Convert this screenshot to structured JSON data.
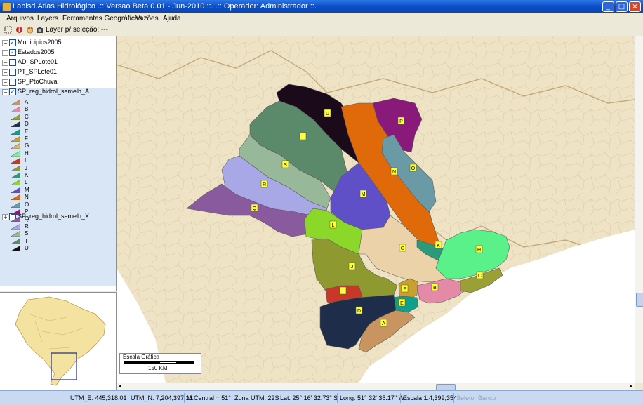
{
  "window": {
    "title": "Labisd.Atlas Hidrológico  .:: Versao Beta 0.01 - Jun-2010 ::.        .:: Operador:  Administrador  ::."
  },
  "menu": [
    "Arquivos",
    "Layers",
    "Ferramentas Geográficas",
    "Vazões",
    "Ajuda"
  ],
  "toolbar": {
    "icons": [
      "select-icon",
      "info-icon",
      "hand-icon",
      "camera-icon"
    ],
    "layer_label": "Layer p/ seleção: ---"
  },
  "layers": [
    {
      "name": "Municipios2005",
      "checked": true
    },
    {
      "name": "Estados2005",
      "checked": true
    },
    {
      "name": "AD_SPLote01",
      "checked": false
    },
    {
      "name": "PT_SPLote01",
      "checked": false
    },
    {
      "name": "SP_PtoChuva",
      "checked": false
    },
    {
      "name": "SP_reg_hidrol_semelh_A",
      "checked": true
    },
    {
      "name": "SP_reg_hidrol_semelh_X",
      "checked": false
    }
  ],
  "legend": [
    {
      "label": "A",
      "color": "#c89460"
    },
    {
      "label": "B",
      "color": "#e58aa6"
    },
    {
      "label": "C",
      "color": "#9aa036"
    },
    {
      "label": "D",
      "color": "#1e2d4a"
    },
    {
      "label": "E",
      "color": "#10a08a"
    },
    {
      "label": "F",
      "color": "#c8a030"
    },
    {
      "label": "G",
      "color": "#d8b870"
    },
    {
      "label": "H",
      "color": "#7cf09a"
    },
    {
      "label": "I",
      "color": "#c83828"
    },
    {
      "label": "J",
      "color": "#8e9a30"
    },
    {
      "label": "K",
      "color": "#2a9a7a"
    },
    {
      "label": "L",
      "color": "#8cd82a"
    },
    {
      "label": "M",
      "color": "#6050c8"
    },
    {
      "label": "N",
      "color": "#e06a0a"
    },
    {
      "label": "O",
      "color": "#6a9aa6"
    },
    {
      "label": "P",
      "color": "#8a1a7a"
    },
    {
      "label": "Q",
      "color": "#8a5a9e"
    },
    {
      "label": "R",
      "color": "#a8a8e6"
    },
    {
      "label": "S",
      "color": "#98b89a"
    },
    {
      "label": "T",
      "color": "#5a8a6a"
    },
    {
      "label": "U",
      "color": "#1a0a1a"
    }
  ],
  "map": {
    "regions": [
      {
        "label": "U",
        "color": "#1a0a1a"
      },
      {
        "label": "P",
        "color": "#8a1a7a"
      },
      {
        "label": "T",
        "color": "#5a8a6a"
      },
      {
        "label": "N",
        "color": "#e06a0a"
      },
      {
        "label": "O",
        "color": "#6a9aa6"
      },
      {
        "label": "S",
        "color": "#98b89a"
      },
      {
        "label": "R",
        "color": "#a8a8e6"
      },
      {
        "label": "Q",
        "color": "#8a5a9e"
      },
      {
        "label": "M",
        "color": "#6050c8"
      },
      {
        "label": "L",
        "color": "#8cd82a"
      },
      {
        "label": "G",
        "color": "#ebd2a8"
      },
      {
        "label": "K",
        "color": "#2a9a7a"
      },
      {
        "label": "H",
        "color": "#5af08a"
      },
      {
        "label": "J",
        "color": "#8e9a30"
      },
      {
        "label": "I",
        "color": "#c83828"
      },
      {
        "label": "F",
        "color": "#c8a030"
      },
      {
        "label": "E",
        "color": "#10a08a"
      },
      {
        "label": "B",
        "color": "#e58aa6"
      },
      {
        "label": "C",
        "color": "#9aa036"
      },
      {
        "label": "D",
        "color": "#1e2d4a"
      },
      {
        "label": "A",
        "color": "#c89460"
      }
    ],
    "scale_title": "Escala Gráfica",
    "scale_text": "150 KM"
  },
  "status": {
    "utm_e": "UTM_E: 445,318.01",
    "utm_n": "UTM_N: 7,204,397.13",
    "mcentral": "M.Central = 51°",
    "zona": "Zona UTM: 22S",
    "lat": "Lat: 25° 16' 32.73\" S",
    "long": "Long: 51° 32' 35.17\" W",
    "escala": "Escala 1:4,399,354",
    "seletor": "Seletor Banco"
  }
}
